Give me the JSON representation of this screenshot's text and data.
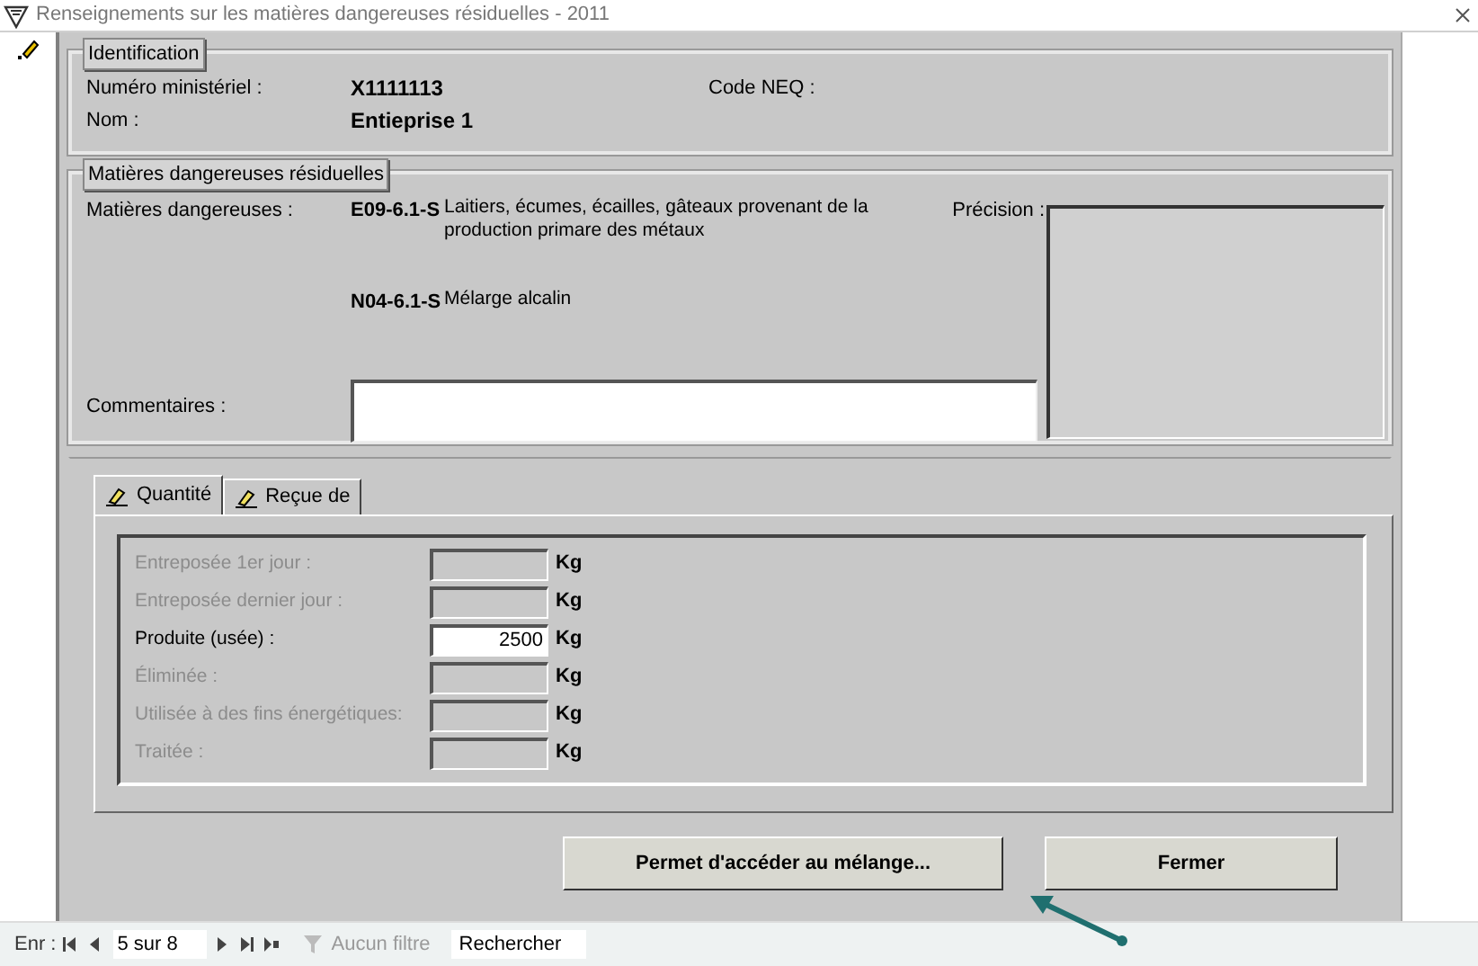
{
  "window": {
    "title": "Renseignements sur les matières dangereuses résiduelles - 2011"
  },
  "identification": {
    "legend": "Identification",
    "fields": [
      {
        "label": "Numéro ministériel :",
        "value": "X1111113"
      },
      {
        "label": "Nom :",
        "value": "Entieprise 1"
      }
    ],
    "neq_label": "Code NEQ :"
  },
  "matieres": {
    "legend": "Matières dangereuses résiduelles",
    "label": "Matières dangereuses :",
    "items": [
      {
        "code": "E09-6.1-S",
        "description": "Laitiers, écumes, écailles, gâteaux provenant de la production primare des métaux"
      },
      {
        "code": "N04-6.1-S",
        "description": "Mélarge alcalin"
      }
    ],
    "precision_label": "Précision :",
    "comments_label": "Commentaires :"
  },
  "tabs": [
    {
      "label": "Quantité",
      "selected": true
    },
    {
      "label": "Reçue de",
      "selected": false
    }
  ],
  "quantities": [
    {
      "label": "Entreposée 1er jour :",
      "unit": "Kg",
      "disabled": true
    },
    {
      "label": "Entreposée dernier jour :",
      "unit": "Kg",
      "disabled": true
    },
    {
      "label": "Produite (usée) :",
      "value": "2500",
      "unit": "Kg",
      "disabled": false
    },
    {
      "label": "Éliminée :",
      "unit": "Kg",
      "disabled": true
    },
    {
      "label": "Utilisée à des fins énergétiques:",
      "unit": "Kg",
      "disabled": true
    },
    {
      "label": "Traitée :",
      "unit": "Kg",
      "disabled": true
    }
  ],
  "buttons": [
    {
      "label": "Permet d'accéder au mélange..."
    },
    {
      "label": "Fermer"
    }
  ],
  "status_bar": {
    "record_label": "Enr :",
    "position": "5 sur 8",
    "filter": "Aucun filtre",
    "search": "Rechercher"
  }
}
